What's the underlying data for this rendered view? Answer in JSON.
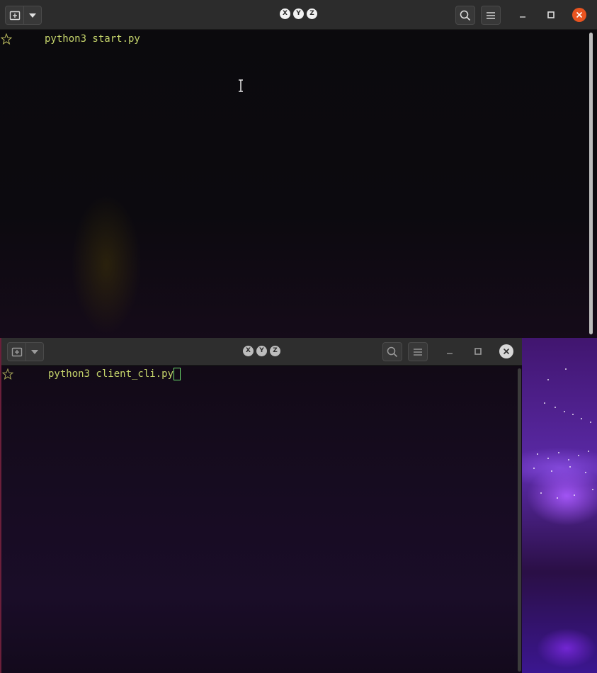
{
  "windows": [
    {
      "title": [
        "X",
        "Y",
        "Z"
      ],
      "command_line": "python3 start.py",
      "focused": true
    },
    {
      "title": [
        "X",
        "Y",
        "Z"
      ],
      "command_line": "python3 client_cli.py",
      "focused": false
    }
  ],
  "colors": {
    "prompt_text": "#c5d46b",
    "close_active": "#e95420",
    "cursor": "#6dde6d"
  },
  "icons": [
    "new-tab-icon",
    "chevron-down-icon",
    "search-icon",
    "hamburger-icon",
    "minimize-icon",
    "maximize-icon",
    "close-icon",
    "star-icon",
    "ibeam-cursor-icon"
  ]
}
